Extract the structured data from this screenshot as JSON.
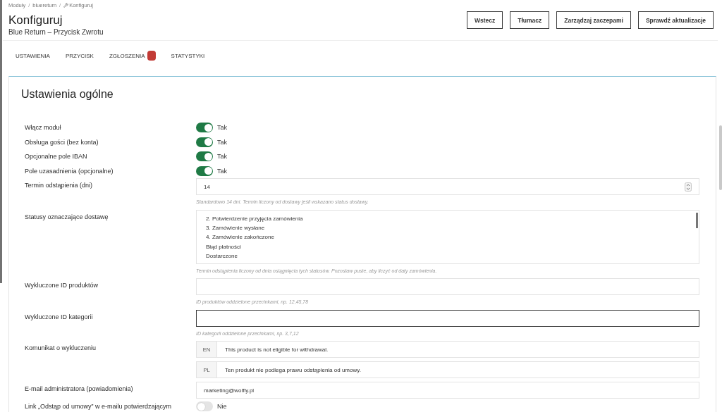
{
  "breadcrumb": {
    "separator": "/",
    "items": [
      {
        "label": "Moduły",
        "kind": "link"
      },
      {
        "label": "bluereturn",
        "kind": "link"
      },
      {
        "label": "Konfiguruj",
        "kind": "current"
      }
    ]
  },
  "header": {
    "title": "Konfiguruj",
    "subtitle": "Blue Return – Przycisk Zwrotu",
    "buttons": [
      "Wstecz",
      "Tłumacz",
      "Zarządzaj zaczepami",
      "Sprawdź aktualizacje"
    ]
  },
  "tabs": [
    {
      "label": "USTAWIENIA",
      "badge": false
    },
    {
      "label": "PRZYCISK",
      "badge": false
    },
    {
      "label": "ZGŁOSZENIA",
      "badge": true
    },
    {
      "label": "STATYSTYKI",
      "badge": false
    }
  ],
  "panel": {
    "title": "Ustawienia ogólne",
    "rows": [
      {
        "kind": "toggle",
        "label": "Włącz moduł",
        "on": true,
        "value": "Tak"
      },
      {
        "kind": "toggle",
        "label": "Obsługa gości (bez konta)",
        "on": true,
        "value": "Tak"
      },
      {
        "kind": "toggle",
        "label": "Opcjonalne pole IBAN",
        "on": true,
        "value": "Tak"
      },
      {
        "kind": "toggle",
        "label": "Pole uzasadnienia (opcjonalne)",
        "on": true,
        "value": "Tak"
      },
      {
        "kind": "number",
        "label": "Termin odstąpienia (dni)",
        "value": "14",
        "help": "Standardowo 14 dni. Termin liczony od dostawy jeśli wskazano status dostawy."
      },
      {
        "kind": "multiselect",
        "label": "Statusy oznaczające dostawę",
        "options": [
          "2. Potwierdzenie przyjęcia zamówienia",
          "3. Zamówienie wysłane",
          "4. Zamówienie zakończone",
          "Błąd płatności",
          "Dostarczone"
        ],
        "help": "Termin odstąpienia liczony od dnia osiągnięcia tych statusów. Pozostaw puste, aby liczyć od daty zamówienia."
      },
      {
        "kind": "text",
        "label": "Wykluczone ID produktów",
        "focused": false,
        "help": "ID produktów oddzielone przecinkami, np. 12,45,78"
      },
      {
        "kind": "text",
        "label": "Wykluczone ID kategorii",
        "focused": true,
        "help": "ID kategorii oddzielone przecinkami, np. 3,7,12"
      },
      {
        "kind": "translated",
        "label": "Komunikat o wykluczeniu",
        "translations": [
          {
            "lang": "EN",
            "value": "This product is not eligible for withdrawal."
          },
          {
            "lang": "PL",
            "value": "Ten produkt nie podlega prawu odstąpienia od umowy."
          }
        ]
      },
      {
        "kind": "text",
        "label": "E-mail administratora (powiadomienia)",
        "value": "marketing@wolfly.pl",
        "focused": false
      },
      {
        "kind": "toggle",
        "label": "Link „Odstąp od umowy” w e-mailu potwierdzającym",
        "on": false,
        "value": "Nie"
      }
    ]
  }
}
